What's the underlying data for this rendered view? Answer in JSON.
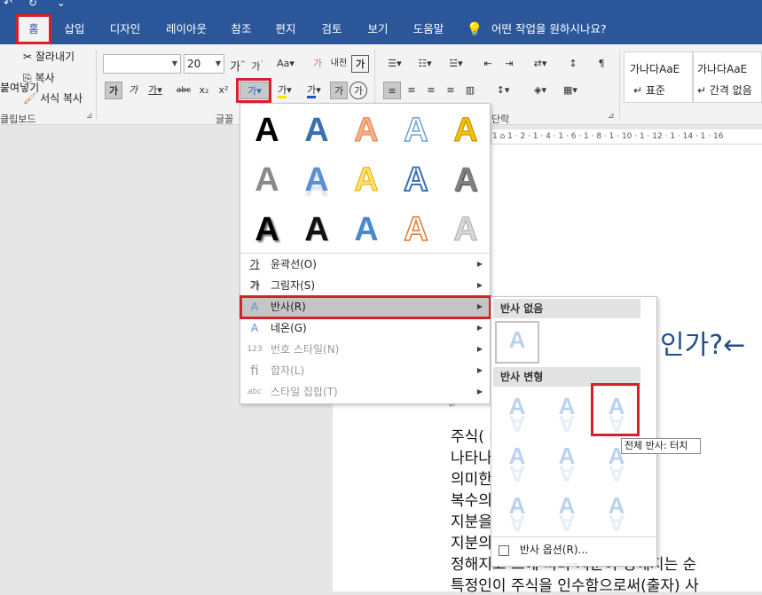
{
  "qat": {
    "undo": "↶",
    "redo": "↻",
    "more": "⌄"
  },
  "tabs": [
    "홈",
    "삽입",
    "디자인",
    "레이아웃",
    "참조",
    "편지",
    "검토",
    "보기",
    "도움말"
  ],
  "tell_me": "어떤 작업을 원하시나요?",
  "clipboard": {
    "cut": "잘라내기",
    "copy": "복사",
    "format_painter": "서식 복사",
    "paste_fragment": "붙여넣기",
    "group_label": "클립보드"
  },
  "font": {
    "name_value": "",
    "size_value": "20",
    "group_label": "글꼴",
    "bold": "가",
    "italic": "가",
    "underline": "가",
    "strike": "abc",
    "sub": "x₂",
    "sup": "x²",
    "text_effects": "가",
    "grow": "가",
    "shrink": "가",
    "case": "Aa",
    "clear": "가",
    "phonetic": "내천",
    "border_char": "가",
    "highlight": "가",
    "font_color": "가",
    "shade": "가",
    "enclose": "가"
  },
  "paragraph": {
    "group_label": "단락"
  },
  "styles": {
    "s1_preview": "가나다AaE",
    "s1_name": "↵ 표준",
    "s2_preview": "가나다AaE",
    "s2_name": "↵ 간격 없음"
  },
  "ruler_text": "1 ⌂ 1 · 2 · 1 · 4 · 1 · 6 · 1 · 8 · 1 · 10 · 1 · 12 · 1 · 14 · 1 · 16",
  "document": {
    "heading_frag": "인가?←",
    "lines": [
      "주식(           k)이란 사원인",
      "나타나           회사의 지분",
      "의미한           나, 주식은 지",
      "복수의           면에서(지분복수",
      "지분을           ) 다만 그 지분",
      "지분의           리적으로 볼 때",
      "정해지고 그에 따라 지분이 정해지는 순",
      "특정인이 주식을 인수함으로써(출자) 사"
    ]
  },
  "menu": {
    "items": [
      {
        "icon": "가",
        "label": "윤곽선(O)",
        "submenu": true,
        "disabled": false
      },
      {
        "icon": "가",
        "label": "그림자(S)",
        "submenu": true,
        "disabled": false
      },
      {
        "icon": "A",
        "label": "반사(R)",
        "submenu": true,
        "disabled": false
      },
      {
        "icon": "A",
        "label": "네온(G)",
        "submenu": true,
        "disabled": false
      },
      {
        "icon": "123",
        "label": "번호 스타일(N)",
        "submenu": true,
        "disabled": true
      },
      {
        "icon": "fi",
        "label": "합자(L)",
        "submenu": true,
        "disabled": true
      },
      {
        "icon": "abc",
        "label": "스타일 집합(T)",
        "submenu": true,
        "disabled": true
      }
    ]
  },
  "submenu": {
    "none_header": "반사 없음",
    "variations_header": "반사 변형",
    "options": "반사 옵션(R)...",
    "tooltip": "전체 반사: 터치"
  },
  "colors": {
    "accent": "#2b579a",
    "highlight_red": "#d9202a"
  }
}
